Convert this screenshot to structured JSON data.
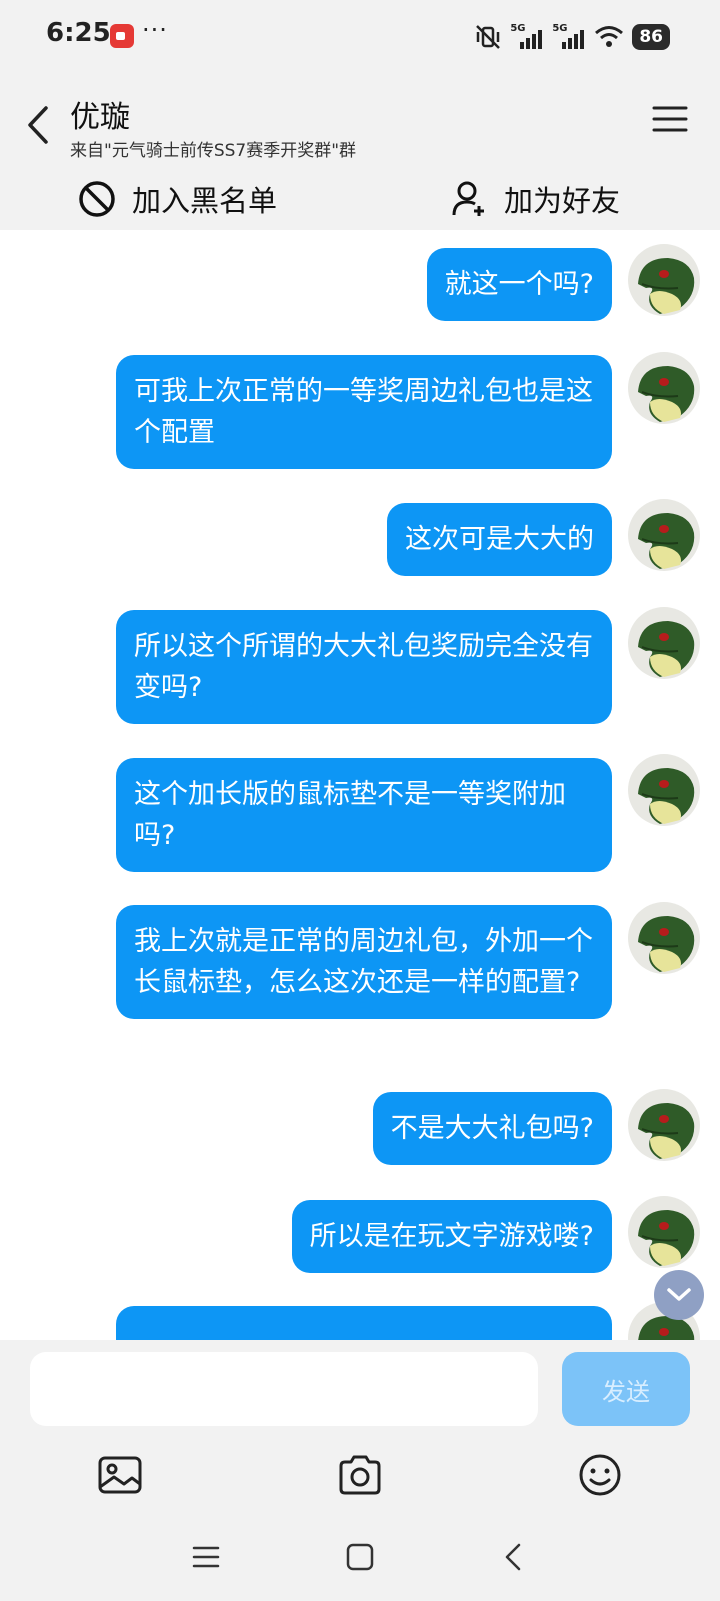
{
  "status_bar": {
    "time": "6:25",
    "more": "···",
    "battery": "86",
    "network": [
      "5G",
      "5G"
    ]
  },
  "header": {
    "title": "优璇",
    "subtitle": "来自\"元气骑士前传SS7赛季开奖群\"群",
    "block_label": "加入黑名单",
    "add_friend_label": "加为好友"
  },
  "messages": [
    {
      "text": "就这一个吗?"
    },
    {
      "text": "可我上次正常的一等奖周边礼包也是这个配置"
    },
    {
      "text": "这次可是大大的"
    },
    {
      "text": "所以这个所谓的大大礼包奖励完全没有变吗?"
    },
    {
      "text": "这个加长版的鼠标垫不是一等奖附加吗?"
    },
    {
      "text": "我上次就是正常的周边礼包，外加一个长鼠标垫，怎么这次还是一样的配置?"
    },
    {
      "text": "不是大大礼包吗?"
    },
    {
      "text": "所以是在玩文字游戏喽?"
    }
  ],
  "composer": {
    "input_value": "",
    "send_label": "发送"
  },
  "colors": {
    "bubble": "#0d96f5",
    "send_disabled": "#7cc3f8",
    "background": "#f2f2f2"
  }
}
